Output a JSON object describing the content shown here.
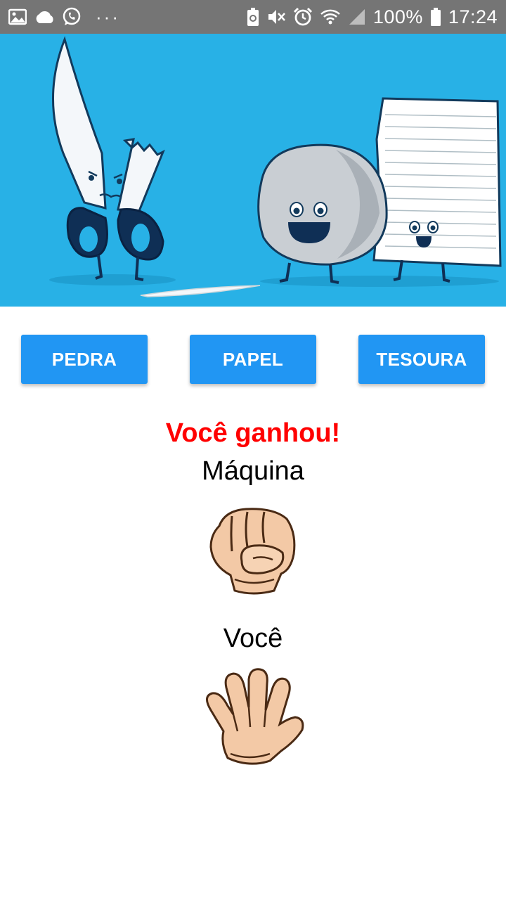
{
  "status_bar": {
    "left_icons": [
      "image-icon",
      "cloud-icon",
      "whatsapp-icon"
    ],
    "more": "···",
    "right_icons": [
      "battery-saver-icon",
      "mute-icon",
      "alarm-icon",
      "wifi-icon",
      "signal-icon"
    ],
    "battery": "100%",
    "time": "17:24",
    "bg_color": "#757575"
  },
  "hero": {
    "image": "scissors-rock-paper-illustration",
    "bg_color": "#28b1e6"
  },
  "buttons": {
    "rock": "PEDRA",
    "paper": "PAPEL",
    "scissors": "TESOURA",
    "color": "#2196f3"
  },
  "result": {
    "text": "Você ganhou!",
    "color": "#ff0000"
  },
  "machine": {
    "label": "Máquina",
    "choice_icon": "fist-icon"
  },
  "player": {
    "label": "Você",
    "choice_icon": "open-hand-icon"
  }
}
